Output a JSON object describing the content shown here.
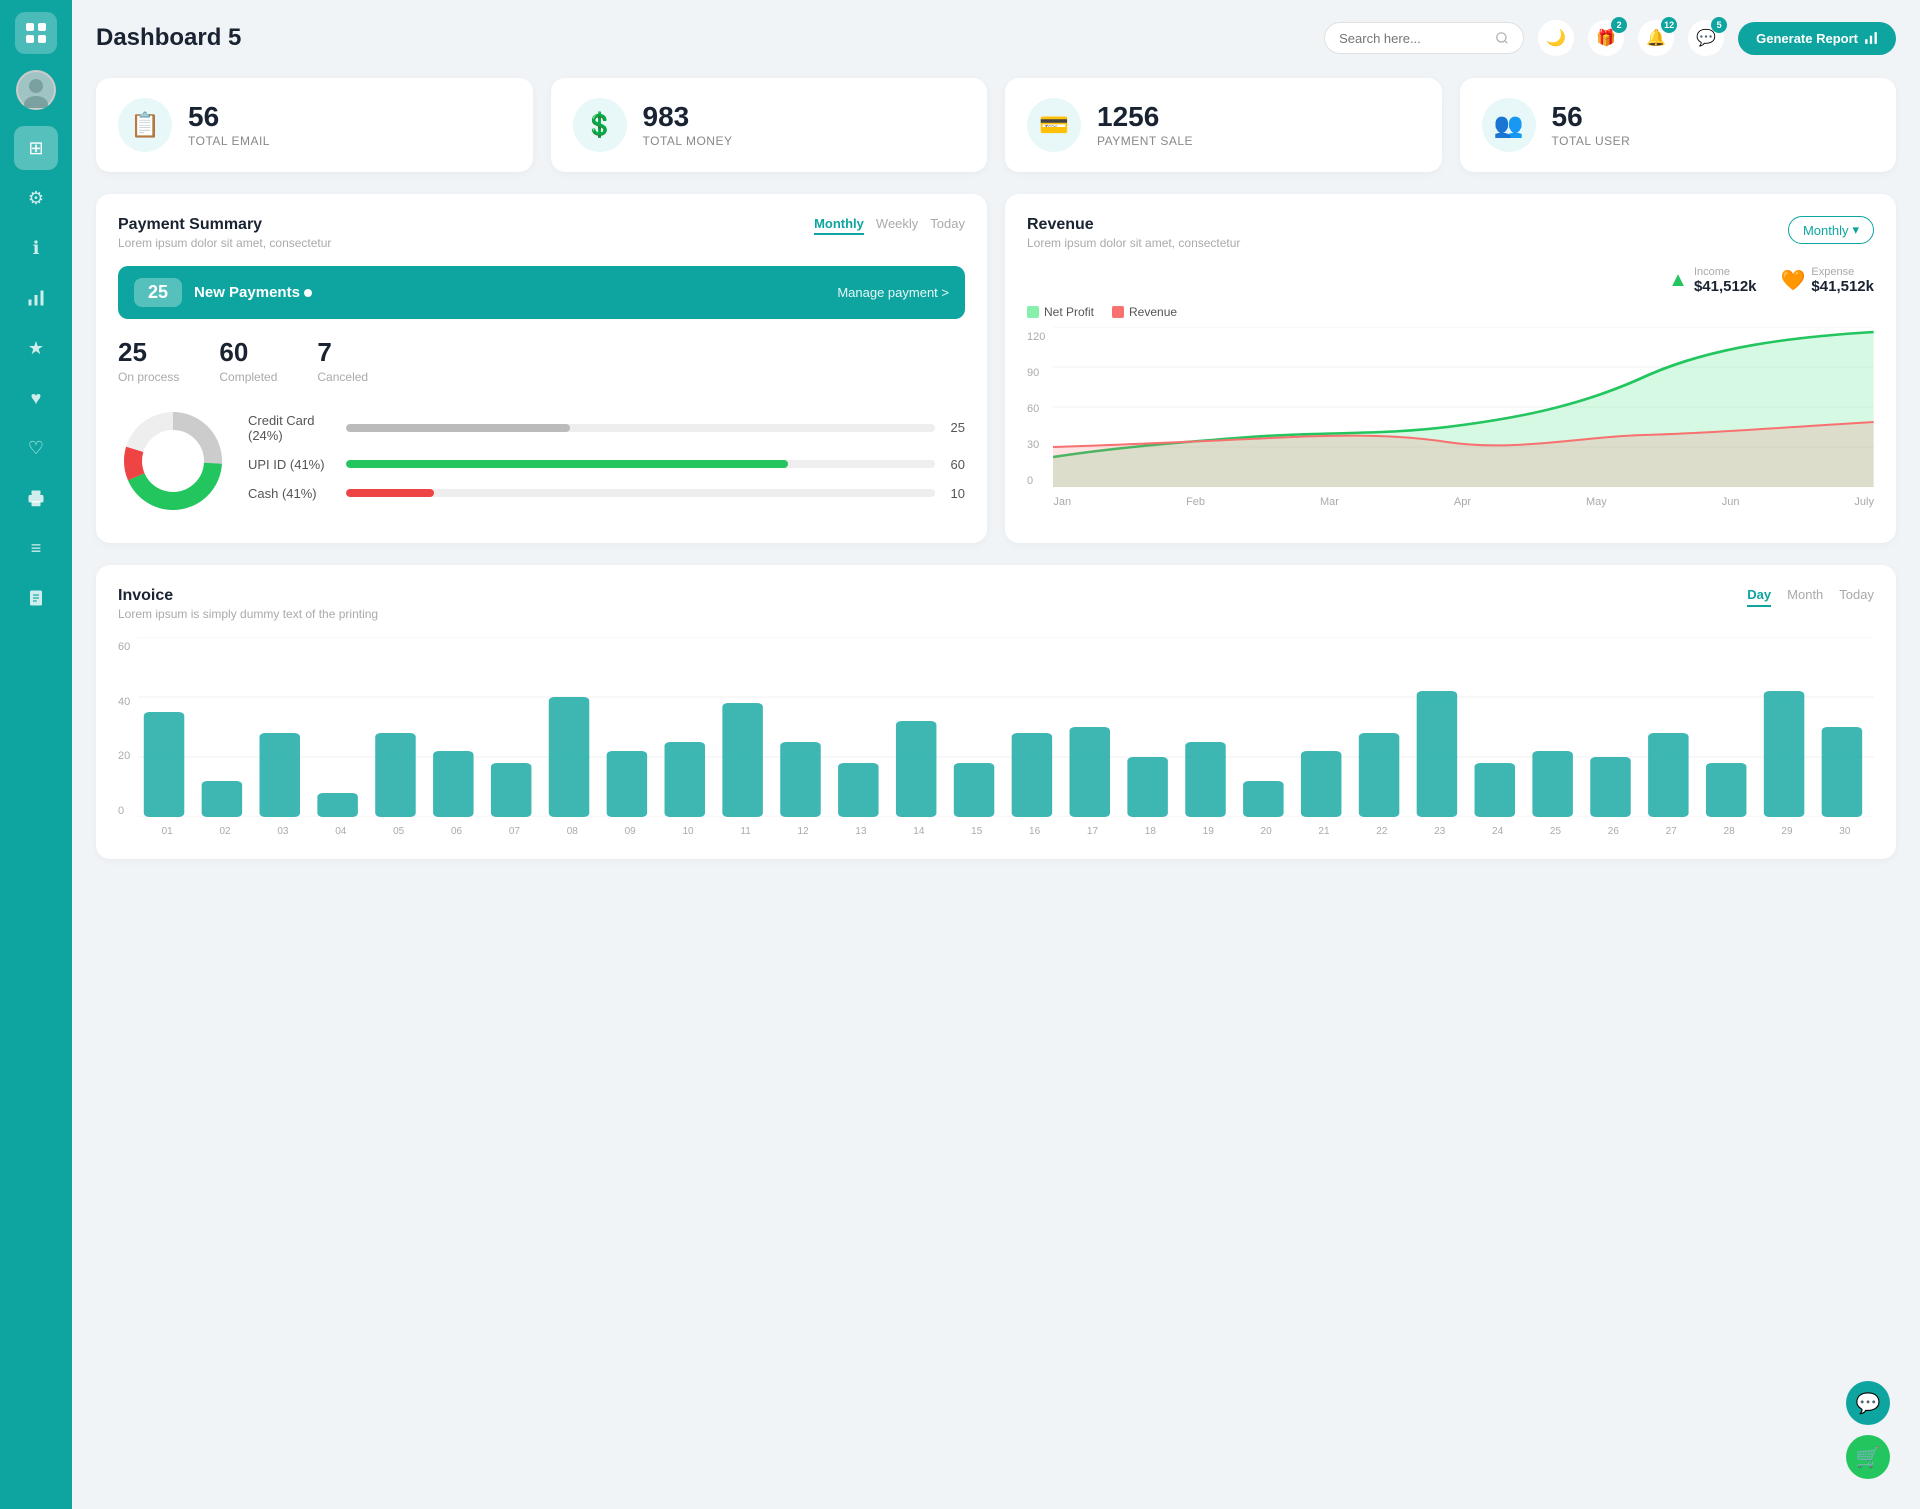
{
  "app": {
    "title": "Dashboard 5"
  },
  "header": {
    "search_placeholder": "Search here...",
    "generate_btn": "Generate Report",
    "badges": {
      "gift": "2",
      "bell": "12",
      "chat": "5"
    }
  },
  "stats": [
    {
      "icon": "📋",
      "number": "56",
      "label": "TOTAL EMAIL"
    },
    {
      "icon": "💲",
      "number": "983",
      "label": "TOTAL MONEY"
    },
    {
      "icon": "💳",
      "number": "1256",
      "label": "PAYMENT SALE"
    },
    {
      "icon": "👥",
      "number": "56",
      "label": "TOTAL USER"
    }
  ],
  "payment_summary": {
    "title": "Payment Summary",
    "subtitle": "Lorem ipsum dolor sit amet, consectetur",
    "tabs": [
      "Monthly",
      "Weekly",
      "Today"
    ],
    "active_tab": "Monthly",
    "new_payments": {
      "count": "25",
      "label": "New Payments",
      "manage": "Manage payment >"
    },
    "stats": [
      {
        "number": "25",
        "label": "On process"
      },
      {
        "number": "60",
        "label": "Completed"
      },
      {
        "number": "7",
        "label": "Canceled"
      }
    ],
    "progress_items": [
      {
        "label": "Credit Card (24%)",
        "value": 25,
        "color": "#bbb",
        "display": "25"
      },
      {
        "label": "UPI ID (41%)",
        "value": 60,
        "color": "#22c55e",
        "display": "60"
      },
      {
        "label": "Cash (41%)",
        "value": 10,
        "color": "#ef4444",
        "display": "10"
      }
    ]
  },
  "revenue": {
    "title": "Revenue",
    "subtitle": "Lorem ipsum dolor sit amet, consectetur",
    "dropdown": "Monthly",
    "income_label": "Income",
    "income_value": "$41,512k",
    "expense_label": "Expense",
    "expense_value": "$41,512k",
    "legend": [
      {
        "label": "Net Profit",
        "color": "#86efac"
      },
      {
        "label": "Revenue",
        "color": "#f87171"
      }
    ],
    "x_labels": [
      "Jan",
      "Feb",
      "Mar",
      "Apr",
      "May",
      "Jun",
      "July"
    ],
    "y_labels": [
      "120",
      "90",
      "60",
      "30",
      "0"
    ]
  },
  "invoice": {
    "title": "Invoice",
    "subtitle": "Lorem ipsum is simply dummy text of the printing",
    "tabs": [
      "Day",
      "Month",
      "Today"
    ],
    "active_tab": "Day",
    "x_labels": [
      "01",
      "02",
      "03",
      "04",
      "05",
      "06",
      "07",
      "08",
      "09",
      "10",
      "11",
      "12",
      "13",
      "14",
      "15",
      "16",
      "17",
      "18",
      "19",
      "20",
      "21",
      "22",
      "23",
      "24",
      "25",
      "26",
      "27",
      "28",
      "29",
      "30"
    ],
    "y_labels": [
      "60",
      "40",
      "20",
      "0"
    ],
    "bars": [
      35,
      12,
      28,
      8,
      28,
      22,
      18,
      40,
      22,
      25,
      38,
      25,
      18,
      32,
      18,
      28,
      30,
      20,
      25,
      12,
      22,
      28,
      42,
      18,
      22,
      20,
      28,
      18,
      42,
      30
    ]
  },
  "sidebar": {
    "items": [
      {
        "icon": "⊞",
        "label": "dashboard",
        "active": true
      },
      {
        "icon": "⚙",
        "label": "settings"
      },
      {
        "icon": "ℹ",
        "label": "info"
      },
      {
        "icon": "📊",
        "label": "analytics"
      },
      {
        "icon": "★",
        "label": "favorites"
      },
      {
        "icon": "♥",
        "label": "liked"
      },
      {
        "icon": "♥",
        "label": "saved"
      },
      {
        "icon": "🖨",
        "label": "print"
      },
      {
        "icon": "≡",
        "label": "menu"
      },
      {
        "icon": "📄",
        "label": "documents"
      }
    ]
  }
}
